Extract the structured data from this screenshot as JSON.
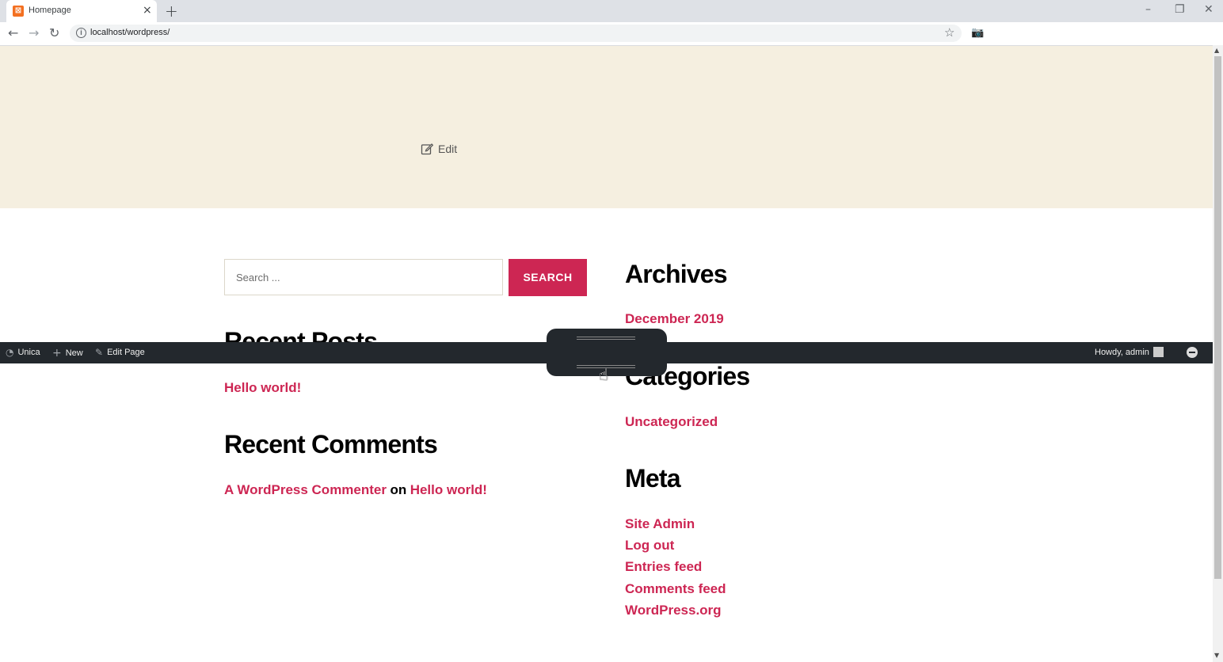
{
  "browser": {
    "tab_title": "Homepage",
    "tab_favicon": "xampp-favicon",
    "url": "localhost/wordpress/",
    "new_tab": "+",
    "close_tab": "×"
  },
  "hero": {
    "edit_label": "Edit"
  },
  "search": {
    "placeholder": "Search ...",
    "button_label": "SEARCH"
  },
  "left_widgets": {
    "recent_posts": {
      "title": "Recent Posts",
      "items": [
        "Hello world!"
      ]
    },
    "recent_comments": {
      "title": "Recent Comments",
      "author": "A WordPress Commenter",
      "joiner": "on",
      "post": "Hello world!"
    }
  },
  "right_widgets": {
    "archives": {
      "title": "Archives",
      "items": [
        "December 2019"
      ]
    },
    "categories": {
      "title": "Categories",
      "items": [
        "Uncategorized"
      ]
    },
    "meta": {
      "title": "Meta",
      "items": [
        "Site Admin",
        "Log out",
        "Entries feed",
        "Comments feed",
        "WordPress.org"
      ]
    }
  },
  "adminbar": {
    "site_name": "Unica",
    "new_label": "New",
    "edit_page_label": "Edit Page",
    "howdy": "Howdy, admin"
  },
  "colors": {
    "accent": "#cd2653",
    "hero_bg": "#f5efe0",
    "adminbar_bg": "#23282d"
  }
}
